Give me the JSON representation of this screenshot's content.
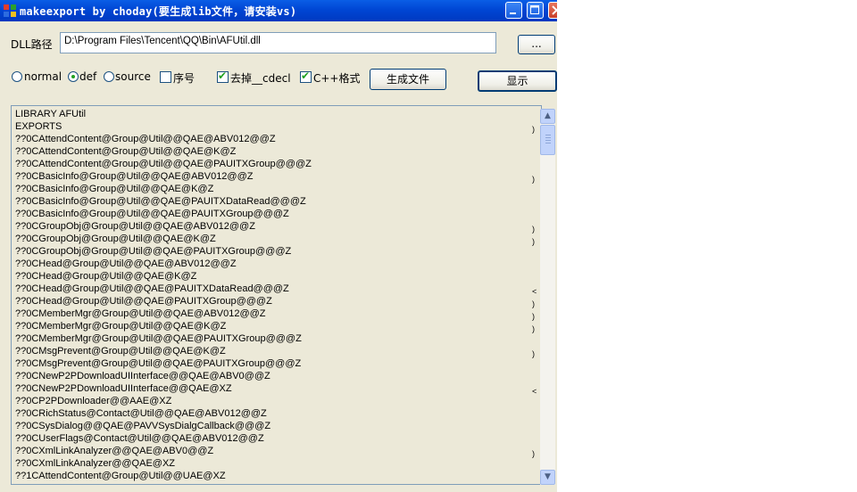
{
  "window": {
    "title": "makeexport by choday(要生成lib文件，请安装vs)",
    "buttons": [
      "minimize",
      "maximize",
      "close"
    ]
  },
  "dll": {
    "label": "DLL路径",
    "path": "D:\\Program Files\\Tencent\\QQ\\Bin\\AFUtil.dll",
    "browse_label": "..."
  },
  "options": {
    "mode": [
      {
        "label": "normal",
        "selected": false
      },
      {
        "label": "def",
        "selected": true
      },
      {
        "label": "source",
        "selected": false
      }
    ],
    "ordinal": {
      "label": "序号",
      "checked": false
    },
    "remove_cdecl": {
      "label": "去掉__cdecl",
      "checked": true
    },
    "cpp_format": {
      "label": "C++格式",
      "checked": true
    },
    "generate_label": "生成文件",
    "show_label": "显示"
  },
  "output": {
    "lines": [
      "LIBRARY AFUtil",
      "EXPORTS",
      "??0CAttendContent@Group@Util@@QAE@ABV012@@Z",
      "??0CAttendContent@Group@Util@@QAE@K@Z",
      "??0CAttendContent@Group@Util@@QAE@PAUITXGroup@@@Z",
      "??0CBasicInfo@Group@Util@@QAE@ABV012@@Z",
      "??0CBasicInfo@Group@Util@@QAE@K@Z",
      "??0CBasicInfo@Group@Util@@QAE@PAUITXDataRead@@@Z",
      "??0CBasicInfo@Group@Util@@QAE@PAUITXGroup@@@Z",
      "??0CGroupObj@Group@Util@@QAE@ABV012@@Z",
      "??0CGroupObj@Group@Util@@QAE@K@Z",
      "??0CGroupObj@Group@Util@@QAE@PAUITXGroup@@@Z",
      "??0CHead@Group@Util@@QAE@ABV012@@Z",
      "??0CHead@Group@Util@@QAE@K@Z",
      "??0CHead@Group@Util@@QAE@PAUITXDataRead@@@Z",
      "??0CHead@Group@Util@@QAE@PAUITXGroup@@@Z",
      "??0CMemberMgr@Group@Util@@QAE@ABV012@@Z",
      "??0CMemberMgr@Group@Util@@QAE@K@Z",
      "??0CMemberMgr@Group@Util@@QAE@PAUITXGroup@@@Z",
      "??0CMsgPrevent@Group@Util@@QAE@K@Z",
      "??0CMsgPrevent@Group@Util@@QAE@PAUITXGroup@@@Z",
      "??0CNewP2PDownloadUIInterface@@QAE@ABV0@@Z",
      "??0CNewP2PDownloadUIInterface@@QAE@XZ",
      "??0CP2PDownloader@@AAE@XZ",
      "??0CRichStatus@Contact@Util@@QAE@ABV012@@Z",
      "??0CSysDialog@@QAE@PAVVSysDialgCallback@@@Z",
      "??0CUserFlags@Contact@Util@@QAE@ABV012@@Z",
      "??0CXmlLinkAnalyzer@@QAE@ABV0@@Z",
      "??0CXmlLinkAnalyzer@@QAE@XZ",
      "??1CAttendContent@Group@Util@@UAE@XZ"
    ]
  }
}
